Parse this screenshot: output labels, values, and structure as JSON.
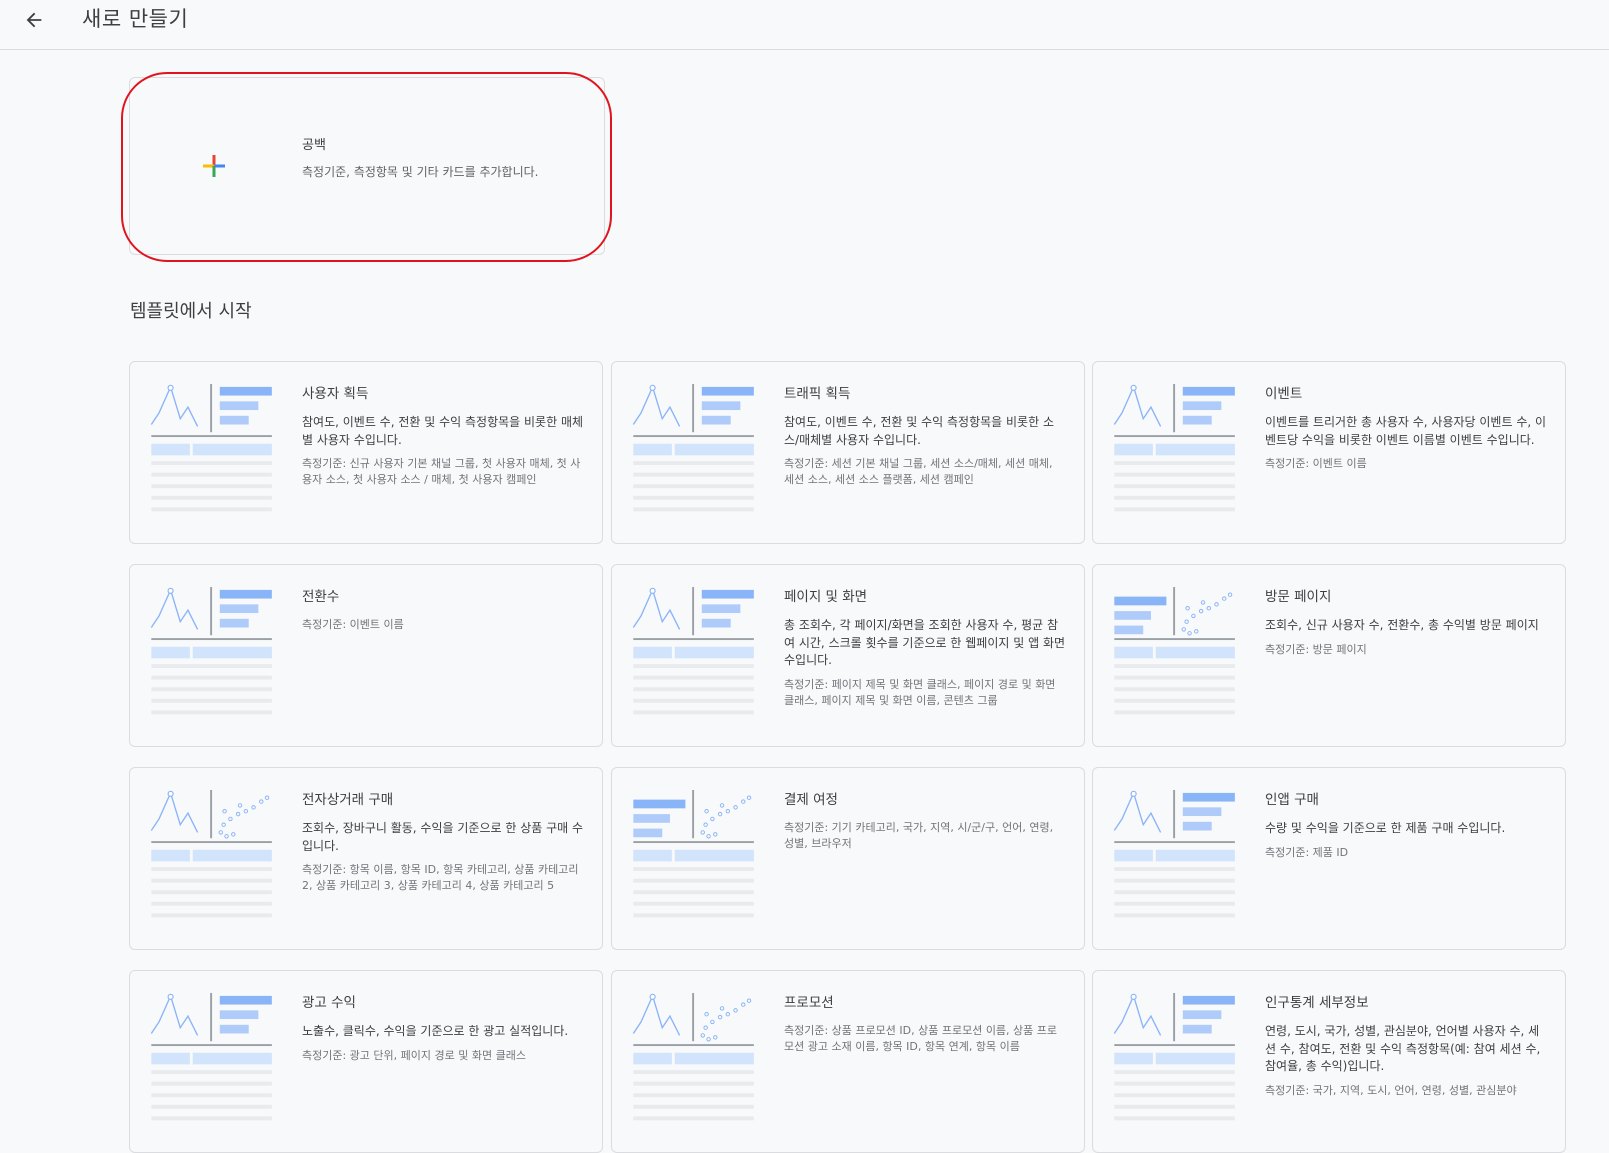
{
  "header": {
    "title": "새로 만들기",
    "back_icon": "arrow-back-icon"
  },
  "blank": {
    "title": "공백",
    "description": "측정기준, 측정항목 및 기타 카드를 추가합니다.",
    "icon": "google-plus-icon",
    "highlight_color": "#e0141e"
  },
  "templates_section": {
    "title": "템플릿에서 시작"
  },
  "colors": {
    "thumb_dark": "#8ab4f8",
    "thumb_light": "#aecbfa",
    "thumb_pale": "#d2e3fc",
    "thumb_gray": "#e8eaed",
    "axis_gray": "#9aa0a6",
    "plus_red": "#ea4335",
    "plus_blue": "#4285f4",
    "plus_yellow": "#fbbc04",
    "plus_green": "#34a853"
  },
  "templates": [
    {
      "title": "사용자 획득",
      "description": "참여도, 이벤트 수, 전환 및 수익 측정항목을 비롯한 매체별 사용자 수입니다.",
      "dimensions": "측정기준: 신규 사용자 기본 채널 그룹, 첫 사용자 매체, 첫 사용자 소스, 첫 사용자 소스 / 매체, 첫 사용자 캠페인",
      "thumb": "line-bars"
    },
    {
      "title": "트래픽 획득",
      "description": "참여도, 이벤트 수, 전환 및 수익 측정항목을 비롯한 소스/매체별 사용자 수입니다.",
      "dimensions": "측정기준: 세션 기본 채널 그룹, 세션 소스/매체, 세션 매체, 세션 소스, 세션 소스 플랫폼, 세션 캠페인",
      "thumb": "line-bars"
    },
    {
      "title": "이벤트",
      "description": "이벤트를 트리거한 총 사용자 수, 사용자당 이벤트 수, 이벤트당 수익을 비롯한 이벤트 이름별 이벤트 수입니다.",
      "dimensions": "측정기준: 이벤트 이름",
      "thumb": "line-bars"
    },
    {
      "title": "전환수",
      "description": "",
      "dimensions": "측정기준: 이벤트 이름",
      "thumb": "line-bars"
    },
    {
      "title": "페이지 및 화면",
      "description": "총 조회수, 각 페이지/화면을 조회한 사용자 수, 평균 참여 시간, 스크롤 횟수를 기준으로 한 웹페이지 및 앱 화면 수입니다.",
      "dimensions": "측정기준: 페이지 제목 및 화면 클래스, 페이지 경로 및 화면 클래스, 페이지 제목 및 화면 이름, 콘텐츠 그룹",
      "thumb": "line-bars"
    },
    {
      "title": "방문 페이지",
      "description": "조회수, 신규 사용자 수, 전환수, 총 수익별 방문 페이지",
      "dimensions": "측정기준: 방문 페이지",
      "thumb": "bars-scatter"
    },
    {
      "title": "전자상거래 구매",
      "description": "조회수, 장바구니 활동, 수익을 기준으로 한 상품 구매 수입니다.",
      "dimensions": "측정기준: 항목 이름, 항목 ID, 항목 카테고리, 상품 카테고리 2, 상품 카테고리 3, 상품 카테고리 4, 상품 카테고리 5",
      "thumb": "line-scatter"
    },
    {
      "title": "결제 여정",
      "description": "",
      "dimensions": "측정기준: 기기 카테고리, 국가, 지역, 시/군/구, 언어, 연령, 성별, 브라우저",
      "thumb": "bars-scatter"
    },
    {
      "title": "인앱 구매",
      "description": "수량 및 수익을 기준으로 한 제품 구매 수입니다.",
      "dimensions": "측정기준: 제품 ID",
      "thumb": "line-bars"
    },
    {
      "title": "광고 수익",
      "description": "노출수, 클릭수, 수익을 기준으로 한 광고 실적입니다.",
      "dimensions": "측정기준: 광고 단위, 페이지 경로 및 화면 클래스",
      "thumb": "line-bars"
    },
    {
      "title": "프로모션",
      "description": "",
      "dimensions": "측정기준: 상품 프로모션 ID, 상품 프로모션 이름, 상품 프로모션 광고 소재 이름, 항목 ID, 항목 연계, 항목 이름",
      "thumb": "line-scatter"
    },
    {
      "title": "인구통계 세부정보",
      "description": "연령, 도시, 국가, 성별, 관심분야, 언어별 사용자 수, 세션 수, 참여도, 전환 및 수익 측정항목(예: 참여 세션 수, 참여율, 총 수익)입니다.",
      "dimensions": "측정기준: 국가, 지역, 도시, 언어, 연령, 성별, 관심분야",
      "thumb": "line-bars"
    }
  ]
}
